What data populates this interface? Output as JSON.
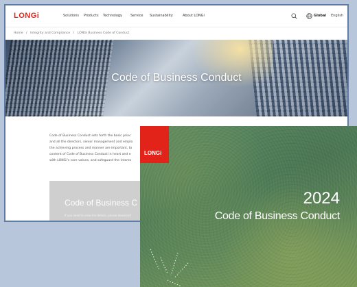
{
  "nav": {
    "logo": "LONGi",
    "items": [
      "Solutions",
      "Products",
      "Technology",
      "Service",
      "Sustainability",
      "About LONGi"
    ],
    "global_label": "Global",
    "language": "English"
  },
  "breadcrumb": [
    "Home",
    "/",
    "Integrity and Compliance",
    "/",
    "LONGi Business Code of Conduct"
  ],
  "hero": {
    "title": "Code of Business Conduct"
  },
  "intro_lines": [
    "Code of Business Conduct sets forth the basic princ",
    "and all the directors, senior management and emplo",
    "the achieving process and manner are important, to",
    "content of Code of Business Conduct in heart and e",
    "with LONGi's core values, and safeguard the interes"
  ],
  "card": {
    "title": "Code of Business C",
    "note": "If you need to view the details, please download"
  },
  "cover": {
    "logo": "LONGi",
    "year": "2024",
    "title": "Code of Business Conduct"
  },
  "colors": {
    "brand": "#e2231a",
    "frame": "#5f7da4",
    "background": "#b7c6da"
  }
}
